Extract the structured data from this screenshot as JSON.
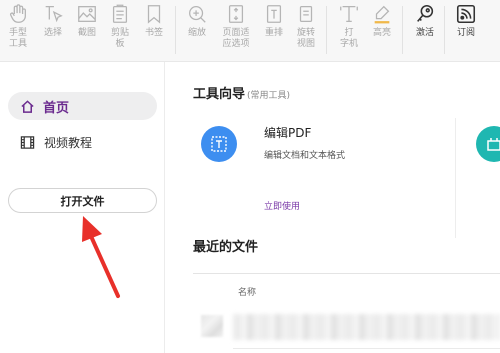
{
  "toolbar": {
    "hand_tool": "手型\n工具",
    "select": "选择",
    "screenshot": "截图",
    "clipboard": "剪贴\n板",
    "bookmark": "书签",
    "zoom": "缩放",
    "fit_page": "页面适\n应选项",
    "reflow": "重排",
    "rotate_view": "旋转\n视图",
    "typewriter": "打\n字机",
    "highlight": "高亮",
    "activate": "激活",
    "subscribe": "订阅"
  },
  "sidebar": {
    "home": "首页",
    "video_tutorial": "视频教程",
    "open_file": "打开文件"
  },
  "main": {
    "tool_wizard": "工具向导",
    "tool_wizard_sub": "(常用工具)",
    "edit_pdf_title": "编辑PDF",
    "edit_pdf_desc": "编辑文档和文本格式",
    "use_now": "立即使用",
    "recent_files": "最近的文件",
    "column_name": "名称"
  },
  "colors": {
    "accent_purple": "#7a3aa8",
    "edit_icon_blue": "#3d8ef0",
    "second_tool_teal": "#1fb7b1",
    "annotation_arrow": "#e8302a"
  }
}
